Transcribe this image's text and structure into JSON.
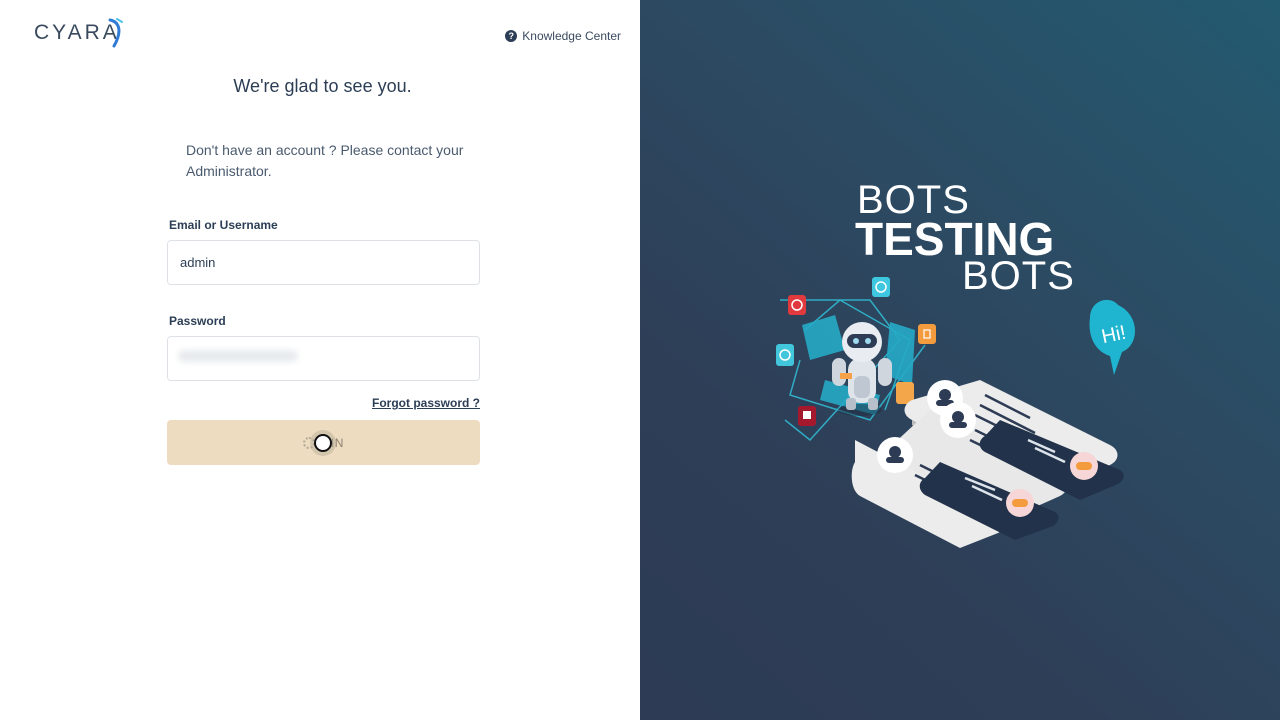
{
  "brand": {
    "logo_text": "CYARA"
  },
  "header": {
    "knowledge_center_label": "Knowledge Center",
    "help_icon": "question-circle-icon"
  },
  "form": {
    "greeting": "We're glad to see you.",
    "note": "Don't have an account ? Please contact your Administrator.",
    "username_label": "Email or Username",
    "username_value": "admin",
    "password_label": "Password",
    "forgot_label": "Forgot password ?",
    "login_label": "GIN"
  },
  "hero": {
    "line1": "BOTS",
    "line2": "TESTING",
    "line3": "BOTS",
    "bubble_text": "Hi!"
  },
  "colors": {
    "primary_text": "#2c3e55",
    "login_button_bg": "#eddcc0",
    "hero_bg": "#2d3b54",
    "accent_teal": "#1fb5d0",
    "accent_orange": "#f7a24a"
  }
}
